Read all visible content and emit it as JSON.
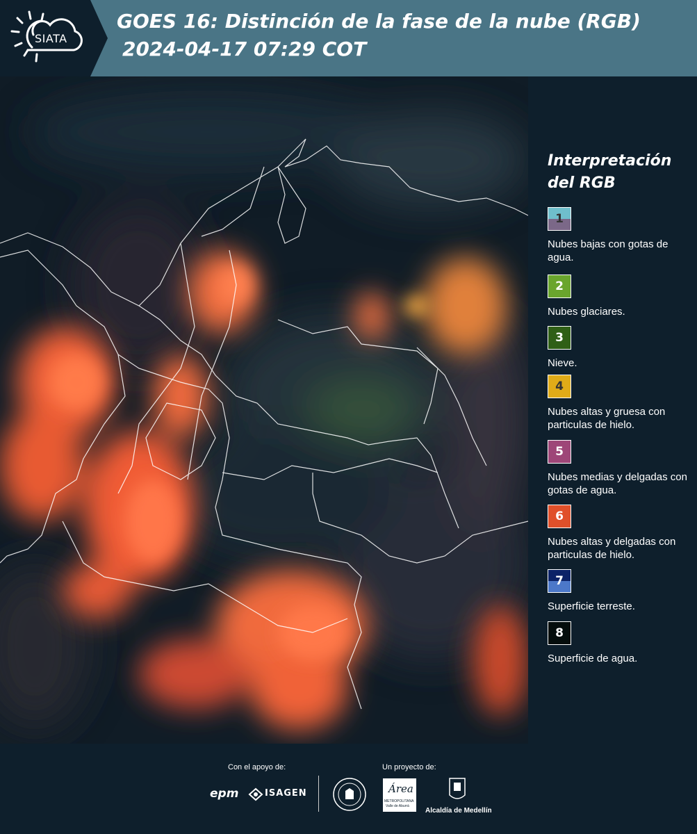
{
  "header": {
    "logo_text": "SIATA",
    "title_line1": "GOES 16: Distinción de la fase de la nube (RGB)",
    "title_line2": "2024-04-17 07:29 COT",
    "bg_color": "#4a7586"
  },
  "legend": {
    "title": "Interpretación del RGB",
    "items": [
      {
        "num": "1",
        "label": "Nubes bajas con gotas de agua.",
        "colors": [
          "#6fbfcc",
          "#7b6888"
        ]
      },
      {
        "num": "2",
        "label": "Nubes glaciares.",
        "colors": [
          "#6aa52d",
          "#6aa52d"
        ]
      },
      {
        "num": "3",
        "label": "Nieve.",
        "colors": [
          "#2f5f16",
          "#2f5f16"
        ]
      },
      {
        "num": "4",
        "label": "Nubes altas y gruesa con particulas de hielo.",
        "colors": [
          "#e0ab18",
          "#e0ab18"
        ]
      },
      {
        "num": "5",
        "label": "Nubes medias y delgadas con gotas de agua.",
        "colors": [
          "#9e4678",
          "#9e4678"
        ]
      },
      {
        "num": "6",
        "label": "Nubes altas y delgadas con particulas de hielo.",
        "colors": [
          "#e0502a",
          "#e0502a"
        ]
      },
      {
        "num": "7",
        "label": "Superficie terreste.",
        "colors": [
          "#0c2267",
          "#4c78c9"
        ]
      },
      {
        "num": "8",
        "label": "Superficie de agua.",
        "colors": [
          "#050d0c",
          "#050d0c"
        ]
      }
    ]
  },
  "footer": {
    "support_label": "Con el apoyo de:",
    "project_label": "Un proyecto de:",
    "epm_logo": "epm",
    "isagen_logo": "ISAGEN",
    "area_logo": "Área",
    "area_sub": "METROPOLITANA",
    "area_sub2": "Valle de Aburrá",
    "alcaldia_logo": "Alcaldía de Medellín"
  }
}
